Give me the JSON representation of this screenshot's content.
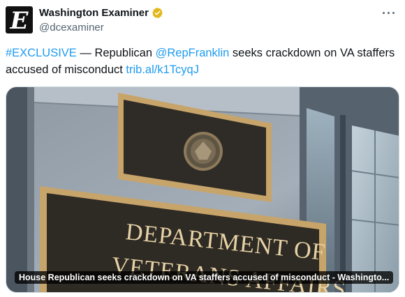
{
  "author": {
    "display_name": "Washington Examiner",
    "handle": "@dcexaminer",
    "avatar_letter": "E",
    "verified_badge": "gold-check-icon",
    "verified_color": "#e2b719"
  },
  "more_menu": "···",
  "tweet": {
    "hashtag": "#EXCLUSIVE",
    "text_part1": " — Republican ",
    "mention": "@RepFranklin",
    "text_part2": " seeks crackdown on VA staffers accused of misconduct ",
    "link": "trib.al/k1TcyqJ"
  },
  "media": {
    "plaque_line1": "DEPARTMENT OF",
    "plaque_line2": "VETERANS AFFAIRS",
    "caption": "House Republican seeks crackdown on VA staffers accused of misconduct - Washingto..."
  },
  "colors": {
    "link": "#1d9bf0",
    "plaque": "#2e2a24",
    "plaque_frame": "#c7a46a"
  }
}
